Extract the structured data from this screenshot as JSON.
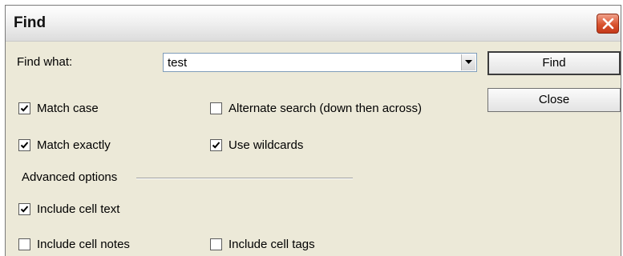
{
  "window": {
    "title": "Find",
    "close_icon": "close-icon"
  },
  "find_what": {
    "label": "Find what:",
    "value": "test"
  },
  "buttons": {
    "find": "Find",
    "close": "Close"
  },
  "options": {
    "match_case": {
      "label": "Match case",
      "checked": true
    },
    "alternate_search": {
      "label": "Alternate search (down then across)",
      "checked": false
    },
    "match_exactly": {
      "label": "Match exactly",
      "checked": true
    },
    "use_wildcards": {
      "label": "Use wildcards",
      "checked": true
    }
  },
  "advanced": {
    "heading": "Advanced options",
    "include_cell_text": {
      "label": "Include cell text",
      "checked": true
    },
    "include_cell_notes": {
      "label": "Include cell notes",
      "checked": false
    },
    "include_cell_tags": {
      "label": "Include cell tags",
      "checked": false
    }
  },
  "colors": {
    "dialog_bg": "#ece9d8",
    "close_button": "#d9532f"
  }
}
